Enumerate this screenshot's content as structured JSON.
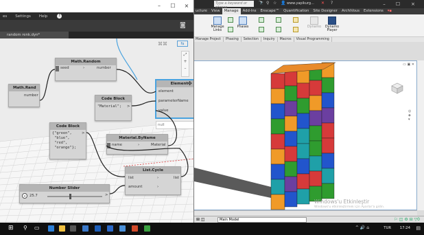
{
  "revit": {
    "search_placeholder": "Type a keyword or phrase",
    "user": "www.yapikurg...",
    "tabs": [
      "ucture",
      "View",
      "Manage",
      "Add-Ins",
      "Enscape™",
      "Quantification",
      "Site Designer",
      "ArchiVous",
      "Extensions"
    ],
    "active_tab": "Manage",
    "ribbon_buttons": {
      "manage_links": "Manage\nLinks",
      "phases": "Phases",
      "dynamo": "Dynamo",
      "dynamo_player": "Dynamo\nPlayer"
    },
    "panels": [
      "Manage Project",
      "Phasing",
      "Selection",
      "Inquiry",
      "Macros",
      "Visual Programming"
    ],
    "status_model": "Main Model",
    "watermark_title": "Windows'u Etkinleştir",
    "watermark_sub": "Windows'u etkinleştirmek için Ayarlar'a gidin."
  },
  "dynamo": {
    "menu": {
      "partial_item": "es",
      "settings": "Settings",
      "help": "Help"
    },
    "tab_title": "random renk.dyn*",
    "null_label": "null",
    "nodes": {
      "math_random": {
        "title": "Math.Random",
        "in": "seed",
        "out": "number"
      },
      "math_rand": {
        "title": "Math.Rand",
        "out": "number"
      },
      "code_block_1": {
        "title": "Code Block",
        "code": "\"Material\";"
      },
      "element_node": {
        "title": "Element",
        "ports": [
          "element",
          "parameterName",
          "value"
        ]
      },
      "code_block_2": {
        "title": "Code Block",
        "code": "{\"green\",\n \"blue\",\n \"red\",\n \"orange\"};"
      },
      "material_byname": {
        "title": "Material.ByName",
        "in": "name",
        "out": "Material"
      },
      "list_cycle": {
        "title": "List.Cycle",
        "in1": "list",
        "in2": "amount",
        "out": "list"
      },
      "number_slider": {
        "title": "Number Slider",
        "value": "25.7"
      }
    }
  },
  "taskbar": {
    "language": "TUR",
    "time": "17:24"
  },
  "colors": {
    "bar_colors": [
      "#2255cc",
      "#2f9c2f",
      "#d63a3a",
      "#f09a28",
      "#6b3fa0",
      "#1fa0a8"
    ],
    "dynamo_wire": "#1f1f1f",
    "selection_blue": "#4aa3df"
  }
}
